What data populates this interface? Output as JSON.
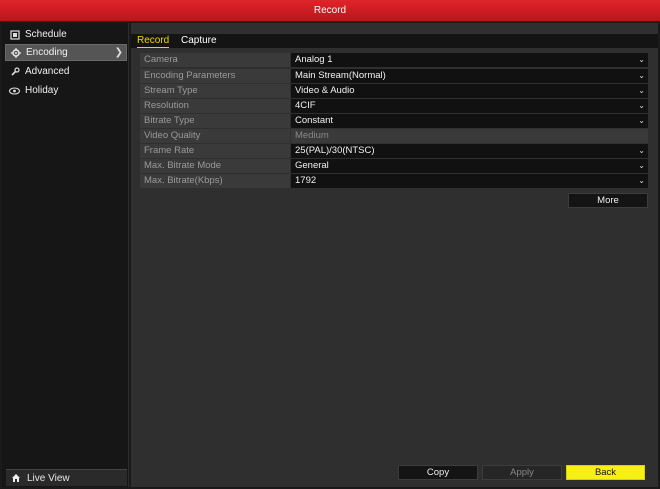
{
  "window": {
    "title": "Record"
  },
  "sidebar": {
    "items": [
      {
        "label": "Schedule",
        "icon": "calendar-icon"
      },
      {
        "label": "Encoding",
        "icon": "gear-icon",
        "active": true
      },
      {
        "label": "Advanced",
        "icon": "wrench-icon"
      },
      {
        "label": "Holiday",
        "icon": "eye-icon"
      }
    ],
    "live_view": {
      "label": "Live View",
      "icon": "home-icon"
    }
  },
  "tabs": [
    {
      "label": "Record",
      "active": true
    },
    {
      "label": "Capture",
      "active": false
    }
  ],
  "form": {
    "rows": [
      {
        "label": "Camera",
        "value": "Analog 1",
        "dropdown": true
      },
      {
        "label": "Encoding Parameters",
        "value": "Main Stream(Normal)",
        "dropdown": true
      },
      {
        "label": "Stream Type",
        "value": "Video & Audio",
        "dropdown": true
      },
      {
        "label": "Resolution",
        "value": "4CIF",
        "dropdown": true
      },
      {
        "label": "Bitrate Type",
        "value": "Constant",
        "dropdown": true
      },
      {
        "label": "Video Quality",
        "value": "Medium",
        "dropdown": false,
        "disabled": true
      },
      {
        "label": "Frame Rate",
        "value": "25(PAL)/30(NTSC)",
        "dropdown": true
      },
      {
        "label": "Max. Bitrate Mode",
        "value": "General",
        "dropdown": true
      },
      {
        "label": "Max. Bitrate(Kbps)",
        "value": "1792",
        "dropdown": true
      }
    ]
  },
  "buttons": {
    "more": "More",
    "copy": "Copy",
    "apply": "Apply",
    "back": "Back"
  },
  "colors": {
    "accent": "#f3d400",
    "titlebar": "#d11e23",
    "primary_button": "#f7f014"
  }
}
